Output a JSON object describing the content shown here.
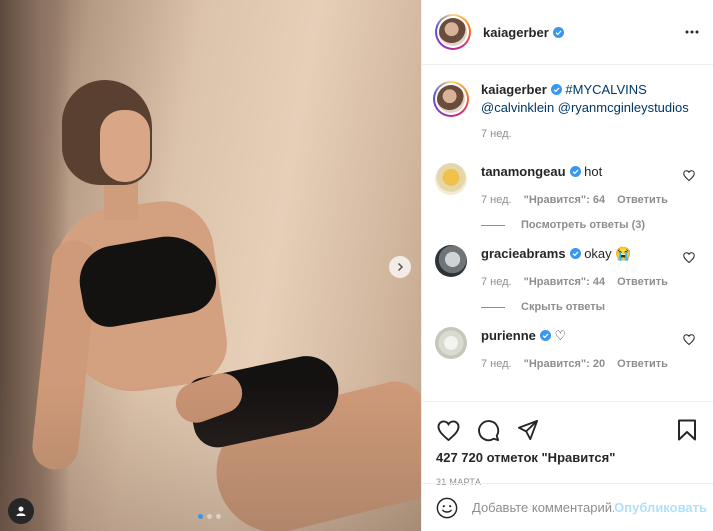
{
  "post": {
    "author": "kaiagerber",
    "carousel": {
      "slide_count": 3,
      "active_slide": 1
    }
  },
  "header": {
    "username": "kaiagerber",
    "verified": true,
    "more_icon": "ellipsis-icon"
  },
  "caption": {
    "username": "kaiagerber",
    "hashtag": "#MYCALVINS",
    "mentions": "@calvinklein @ryanmcginleystudios",
    "time": "7 нед."
  },
  "comments": [
    {
      "username": "tanamongeau",
      "verified": true,
      "text": "hot",
      "time": "7 нед.",
      "likes": "\"Нравится\": 64",
      "reply": "Ответить",
      "replies_toggle": "Посмотреть ответы (3)"
    },
    {
      "username": "gracieabrams",
      "verified": true,
      "text": "okay 😭",
      "time": "7 нед.",
      "likes": "\"Нравится\": 44",
      "reply": "Ответить",
      "replies_toggle": "Скрыть ответы"
    },
    {
      "username": "purienne",
      "verified": true,
      "text": "♡",
      "time": "7 нед.",
      "likes": "\"Нравится\": 20",
      "reply": "Ответить"
    }
  ],
  "actions": {
    "icons": [
      "heart-icon",
      "comment-icon",
      "share-icon",
      "bookmark-icon"
    ],
    "likes_text": "427 720 отметок \"Нравится\"",
    "date": "31 МАРТА"
  },
  "add_comment": {
    "placeholder": "Добавьте комментарий...",
    "publish_label": "Опубликовать"
  },
  "colors": {
    "verified": "#3897f0",
    "link": "#00376b",
    "muted": "#8e8e8e",
    "publish_disabled": "#b2dffc",
    "active_dot": "#3797f0"
  }
}
